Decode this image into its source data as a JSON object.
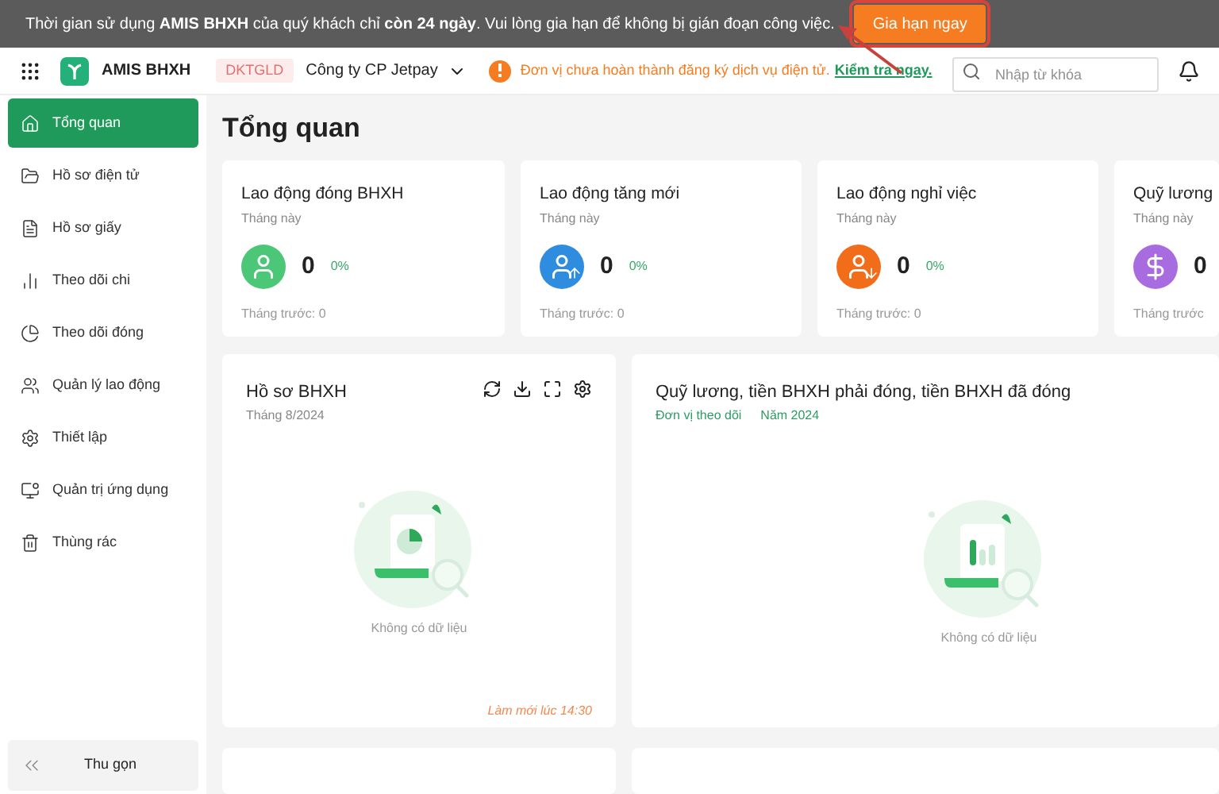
{
  "banner": {
    "message": "Thời gian sử dụng **AMIS BHXH** của quý khách chỉ **còn 24 ngày**. Vui lòng gia hạn để không bị gián đoạn công việc.",
    "button": "Gia hạn ngay",
    "highlighted": true
  },
  "header": {
    "app_name": "AMIS BHXH",
    "company_code": "DKTGLD",
    "company": "Công ty CP Jetpay",
    "notice": "Đơn vị chưa hoàn thành đăng ký dịch vụ điện tử.",
    "notice_link": "Kiểm tra ngay.",
    "search": {
      "placeholder": "Nhập từ khóa"
    }
  },
  "sidebar": {
    "items": [
      {
        "label": "Tổng quan",
        "kind": "home",
        "selected": true
      },
      {
        "label": "Hồ sơ điện tử",
        "kind": "folder",
        "selected": false
      },
      {
        "label": "Hồ sơ giấy",
        "kind": "file",
        "selected": false
      },
      {
        "label": "Theo dõi chi",
        "kind": "chart",
        "selected": false
      },
      {
        "label": "Theo dõi đóng",
        "kind": "pie",
        "selected": false
      },
      {
        "label": "Quản lý lao động",
        "kind": "users",
        "selected": false
      },
      {
        "label": "Thiết lập",
        "kind": "settings",
        "selected": false
      },
      {
        "label": "Quản trị ứng dụng",
        "kind": "monitor",
        "selected": false
      },
      {
        "label": "Thùng rác",
        "kind": "trash",
        "selected": false
      }
    ],
    "collapse": "Thu gọn"
  },
  "page_title": "Tổng quan",
  "stats": [
    {
      "title": "Lao động đóng BHXH",
      "period": "Tháng này",
      "value": "0",
      "change": "0%",
      "previous": "Tháng trước: 0",
      "kind": "user",
      "color": "#4cc777"
    },
    {
      "title": "Lao động tăng mới",
      "period": "Tháng này",
      "value": "0",
      "change": "0%",
      "previous": "Tháng trước: 0",
      "kind": "user-up",
      "color": "#2f8de0"
    },
    {
      "title": "Lao động nghỉ việc",
      "period": "Tháng này",
      "value": "0",
      "change": "0%",
      "previous": "Tháng trước: 0",
      "kind": "user-down",
      "color": "#f26d1a"
    },
    {
      "title": "Quỹ lương",
      "period": "Tháng này",
      "value": "0",
      "previous": "Tháng trước",
      "kind": "dollar",
      "color": "#a86be0"
    }
  ],
  "panels": [
    {
      "title": "Hồ sơ BHXH",
      "subtitles": [
        "Tháng 8/2024"
      ],
      "empty": "Không có dữ liệu",
      "refreshed": "Làm mới lúc 14:30",
      "kind": "pie"
    },
    {
      "title": "Quỹ lương, tiền BHXH phải đóng, tiền BHXH đã đóng",
      "subtitles": [
        "Đơn vị theo dõi",
        "Năm 2024"
      ],
      "empty": "Không có dữ liệu",
      "kind": "bars"
    }
  ]
}
